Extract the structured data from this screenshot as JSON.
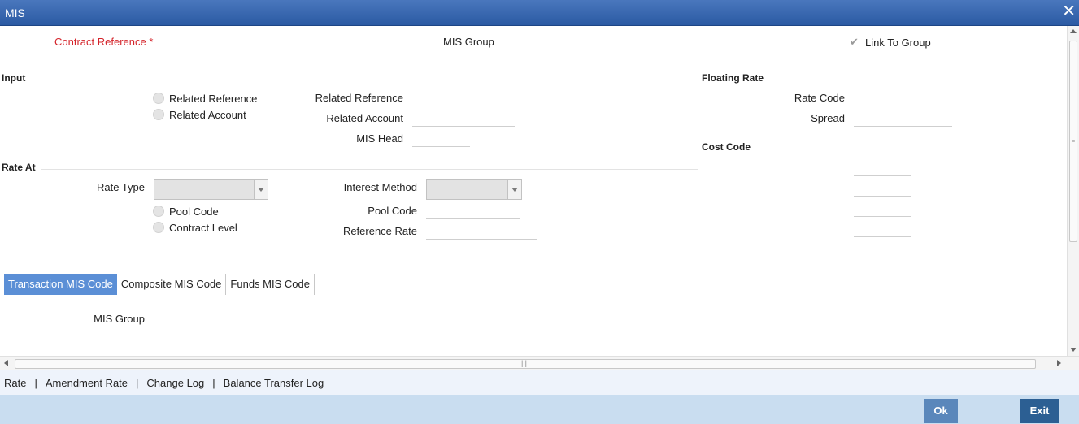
{
  "window": {
    "title": "MIS"
  },
  "header": {
    "contract_reference_label": "Contract Reference",
    "required_marker": "*",
    "mis_group_label": "MIS Group",
    "link_to_group_label": "Link To Group",
    "link_to_group_checked": true
  },
  "input_section": {
    "title": "Input",
    "radio_related_reference": "Related Reference",
    "radio_related_account": "Related Account",
    "related_reference_label": "Related Reference",
    "related_account_label": "Related Account",
    "mis_head_label": "MIS Head"
  },
  "floating_rate": {
    "title": "Floating Rate",
    "rate_code_label": "Rate Code",
    "spread_label": "Spread"
  },
  "cost_code": {
    "title": "Cost Code"
  },
  "rate_at": {
    "title": "Rate At",
    "rate_type_label": "Rate Type",
    "interest_method_label": "Interest Method",
    "radio_pool_code": "Pool Code",
    "radio_contract_level": "Contract Level",
    "pool_code_label": "Pool Code",
    "reference_rate_label": "Reference Rate"
  },
  "tabs": [
    {
      "label": "Transaction MIS Code",
      "active": true
    },
    {
      "label": "Composite MIS Code",
      "active": false
    },
    {
      "label": "Funds MIS Code",
      "active": false
    }
  ],
  "tab_content": {
    "mis_group_label": "MIS Group"
  },
  "bottom_links": [
    "Rate",
    "Amendment Rate",
    "Change Log",
    "Balance Transfer Log"
  ],
  "link_separator": "|",
  "buttons": {
    "ok": "Ok",
    "exit": "Exit"
  },
  "colors": {
    "titlebar": "#2b5aa3",
    "required": "#d4232a",
    "active_tab": "#5b8fd6",
    "footer": "#c9ddf0",
    "ok_button": "#5a87bb",
    "exit_button": "#2c5f93"
  }
}
